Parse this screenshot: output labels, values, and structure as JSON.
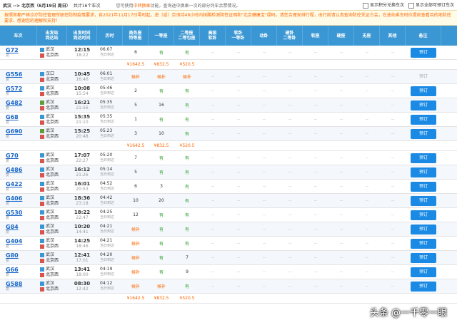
{
  "topbar": {
    "route": "武汉 --> 北京西（6月19日 周日）",
    "count": "共计16个车次",
    "tip_prefix": "您可使用",
    "tip_link": "中转换乘",
    "tip_suffix": "功能，查询途中换乘一次的部分列车余票情况。",
    "opt1": "显示积分兑换车次",
    "opt2": "显示全部可预订车次"
  },
  "notice": "按照首都严格诊疗防控管理所联控防制疫情要求，自2021年11月17日零时起，进（返）京须持48小时内核酸检测阴性证明和\"北京健康宝\"绿码。请您合理安排行程，出行前请认真查询防控凭证方会，在途站乘车时应提前查看目的地防控要求，感谢您的理解和支持！",
  "headers": [
    {
      "key": "train",
      "label": "车次"
    },
    {
      "key": "stn",
      "label": "出发站\n到达站"
    },
    {
      "key": "time",
      "label": "出发时间\n到达时间"
    },
    {
      "key": "dur",
      "label": "历时"
    },
    {
      "key": "s1",
      "label": "商务座\n特等座"
    },
    {
      "key": "s2",
      "label": "一等座"
    },
    {
      "key": "s3",
      "label": "二等座\n二等包座"
    },
    {
      "key": "s4",
      "label": "高级\n软卧"
    },
    {
      "key": "s5",
      "label": "软卧\n一等卧"
    },
    {
      "key": "s6",
      "label": "动卧"
    },
    {
      "key": "s7",
      "label": "硬卧\n二等卧"
    },
    {
      "key": "s8",
      "label": "软座"
    },
    {
      "key": "s9",
      "label": "硬座"
    },
    {
      "key": "s10",
      "label": "无座"
    },
    {
      "key": "s11",
      "label": "其他"
    },
    {
      "key": "note",
      "label": "备注"
    }
  ],
  "labels": {
    "dash": "--",
    "book": "预订",
    "fuxing": "复"
  },
  "trains": [
    {
      "no": "G72",
      "from": "武汉",
      "to": "北京西",
      "dep": "12:15",
      "arr": "18:22",
      "dur": "06:07",
      "arrday": "当日到达",
      "seats": [
        "6",
        "有",
        "有"
      ],
      "book": true,
      "price": [
        "¥1642.5",
        "¥832.5",
        "¥520.5"
      ],
      "fi": "s"
    },
    {
      "no": "G556",
      "from": "汉口",
      "to": "北京西",
      "dep": "10:45",
      "arr": "16:46",
      "dur": "06:01",
      "arrday": "当日到达",
      "seats": [
        "候补",
        "候补",
        "候补"
      ],
      "book": false,
      "fi": "s"
    },
    {
      "no": "G572",
      "from": "武汉",
      "to": "北京西",
      "dep": "10:08",
      "arr": "15:54",
      "dur": "05:46",
      "arrday": "当日到达",
      "seats": [
        "2",
        "有",
        "有"
      ],
      "book": true,
      "fi": "s"
    },
    {
      "no": "G482",
      "from": "武汉",
      "to": "北京西",
      "dep": "16:21",
      "arr": "21:56",
      "dur": "05:35",
      "arrday": "当日到达",
      "seats": [
        "5",
        "16",
        "有"
      ],
      "book": true,
      "fi": "g"
    },
    {
      "no": "G68",
      "from": "武汉",
      "to": "北京西",
      "dep": "15:35",
      "arr": "21:10",
      "dur": "05:35",
      "arrday": "当日到达",
      "seats": [
        "1",
        "有",
        "有"
      ],
      "book": true,
      "fi": "s"
    },
    {
      "no": "G690",
      "from": "武汉",
      "to": "北京西",
      "dep": "15:25",
      "arr": "20:48",
      "dur": "05:23",
      "arrday": "当日到达",
      "seats": [
        "3",
        "10",
        "有"
      ],
      "book": true,
      "price": [
        "¥1642.5",
        "¥832.5",
        "¥520.5"
      ],
      "fi": "g"
    },
    {
      "no": "G70",
      "from": "武汉",
      "to": "北京西",
      "dep": "17:07",
      "arr": "22:27",
      "dur": "05:20",
      "arrday": "当日到达",
      "seats": [
        "7",
        "有",
        "有"
      ],
      "book": true,
      "fi": "s"
    },
    {
      "no": "G486",
      "from": "武汉",
      "to": "北京西",
      "dep": "16:12",
      "arr": "21:26",
      "dur": "05:14",
      "arrday": "当日到达",
      "seats": [
        "5",
        "有",
        "有"
      ],
      "book": true,
      "fi": "s"
    },
    {
      "no": "G422",
      "from": "武汉",
      "to": "北京西",
      "dep": "16:01",
      "arr": "20:53",
      "dur": "04:52",
      "arrday": "当日到达",
      "seats": [
        "6",
        "3",
        "有"
      ],
      "book": true,
      "fi": "s"
    },
    {
      "no": "G406",
      "from": "武汉",
      "to": "北京西",
      "dep": "18:36",
      "arr": "23:18",
      "dur": "04:42",
      "arrday": "当日到达",
      "seats": [
        "10",
        "20",
        "有"
      ],
      "book": true,
      "fi": "s"
    },
    {
      "no": "G530",
      "from": "武汉",
      "to": "北京西",
      "dep": "18:22",
      "arr": "22:47",
      "dur": "04:25",
      "arrday": "当日到达",
      "seats": [
        "12",
        "有",
        "有"
      ],
      "book": true,
      "fi": "s"
    },
    {
      "no": "G84",
      "from": "武汉",
      "to": "北京西",
      "dep": "10:20",
      "arr": "14:41",
      "dur": "04:21",
      "arrday": "当日到达",
      "seats": [
        "候补",
        "有",
        "有"
      ],
      "book": true,
      "fi": "s"
    },
    {
      "no": "G404",
      "from": "武汉",
      "to": "北京西",
      "dep": "14:25",
      "arr": "18:46",
      "dur": "04:21",
      "arrday": "当日到达",
      "seats": [
        "候补",
        "有",
        "有"
      ],
      "book": true,
      "fi": "s"
    },
    {
      "no": "G80",
      "from": "武汉",
      "to": "北京西",
      "dep": "12:41",
      "arr": "17:01",
      "dur": "04:20",
      "arrday": "当日到达",
      "seats": [
        "候补",
        "有",
        "7"
      ],
      "book": true,
      "fi": "s"
    },
    {
      "no": "G66",
      "from": "武汉",
      "to": "北京西",
      "dep": "13:41",
      "arr": "18:00",
      "dur": "04:19",
      "arrday": "当日到达",
      "seats": [
        "候补",
        "有",
        "9"
      ],
      "book": true,
      "fi": "s"
    },
    {
      "no": "G588",
      "from": "武汉",
      "to": "北京西",
      "dep": "08:30",
      "arr": "12:42",
      "dur": "04:12",
      "arrday": "当日到达",
      "seats": [
        "候补",
        "候补",
        "有"
      ],
      "book": true,
      "price": [
        "¥1642.5",
        "¥832.5",
        "¥520.5"
      ],
      "fi": "s"
    }
  ],
  "watermark": "头条 @一千零一眼",
  "colors": {
    "header": "#3b97d3",
    "button": "#1a8ae5",
    "available": "#2a9d2a",
    "waitlist": "#ff6600",
    "notice_bg": "#fffbe6",
    "notice_text": "#ff6600"
  }
}
